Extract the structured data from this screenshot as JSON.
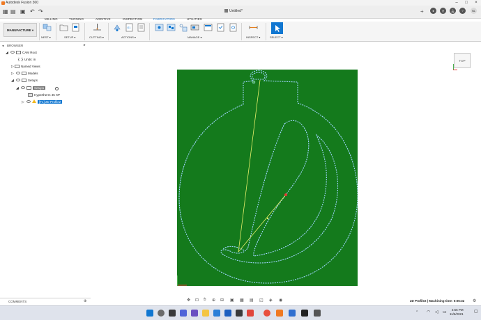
{
  "window": {
    "title": "Autodesk Fusion 360",
    "document_title": "Untitled*",
    "user_initials": "NL"
  },
  "tabs": [
    "MILLING",
    "TURNING",
    "ADDITIVE",
    "INSPECTION",
    "FABRICATION",
    "UTILITIES"
  ],
  "active_tab": "FABRICATION",
  "workspace": "MANUFACTURE",
  "ribbon_groups": [
    "NEST",
    "SETUP",
    "CUTTING",
    "ACTIONS",
    "MANAGE",
    "INSPECT",
    "SELECT"
  ],
  "browser": {
    "title": "BROWSER",
    "items": [
      {
        "label": "CAM Root"
      },
      {
        "label": "Units: in"
      },
      {
        "label": "Named Views"
      },
      {
        "label": "Models"
      },
      {
        "label": "Setups"
      },
      {
        "label": "Setup1"
      },
      {
        "label": "Hypertherm 45 XP"
      },
      {
        "label": "[T1] 2D Profile2"
      }
    ]
  },
  "viewcube": {
    "label": "TOP"
  },
  "comments": {
    "label": "COMMENTS"
  },
  "status": {
    "text": "2D Profile2 | Machining time: 0:06:32"
  },
  "clock": {
    "time": "4:56 PM",
    "date": "11/6/2021"
  },
  "colors": {
    "canvas_green": "#147a1c",
    "toolpath_blue": "#9fd6ff",
    "rapid_yellow": "#e8f06a",
    "accent_blue": "#1177d1"
  },
  "icons": [
    "search-icon",
    "chevron-down-icon",
    "gear-icon",
    "warning-icon",
    "eye-icon",
    "folder-icon"
  ]
}
